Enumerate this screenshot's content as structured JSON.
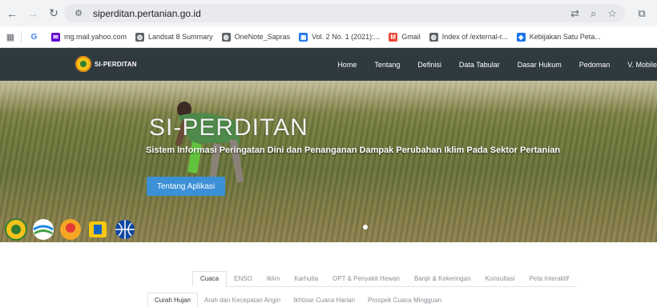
{
  "browser": {
    "url": "siperditan.pertanian.go.id",
    "bookmarks": [
      {
        "label": "mg.mail.yahoo.com",
        "color": "#6001d2",
        "glyph": "✉"
      },
      {
        "label": "Landsat 8 Summary",
        "color": "#5f6368",
        "glyph": "◍"
      },
      {
        "label": "OneNote_Sapras",
        "color": "#5f6368",
        "glyph": "◍"
      },
      {
        "label": "Vol. 2 No. 1 (2021):...",
        "color": "#1a73e8",
        "glyph": "▣"
      },
      {
        "label": "Gmail",
        "color": "#ea4335",
        "glyph": "M"
      },
      {
        "label": "Index of /external-r...",
        "color": "#5f6368",
        "glyph": "◍"
      },
      {
        "label": "Kebijakan Satu Peta...",
        "color": "#1a73e8",
        "glyph": "◆"
      }
    ]
  },
  "site": {
    "logo_text": "SI-PERDITAN",
    "menu": [
      "Home",
      "Tentang",
      "Definisi",
      "Data Tabular",
      "Dasar Hukum",
      "Pedoman",
      "V. Mobile"
    ]
  },
  "hero": {
    "title": "SI-PERDITAN",
    "subtitle": "Sistem Informasi Peringatan Dini dan Penanganan Dampak Perubahan Iklim Pada Sektor Pertanian",
    "button": "Tentang Aplikasi"
  },
  "tabs": [
    "Cuaca",
    "ENSO",
    "Iklim",
    "Karhutla",
    "OPT & Penyakit Hewan",
    "Banjir & Kekeringan",
    "Konsultasi",
    "Peta Interaktif"
  ],
  "subtabs": [
    "Curah Hujan",
    "Arah dan Kecepatan Angin",
    "Ikhtisar Cuaca Harian",
    "Prospek Cuaca Mingguan"
  ]
}
